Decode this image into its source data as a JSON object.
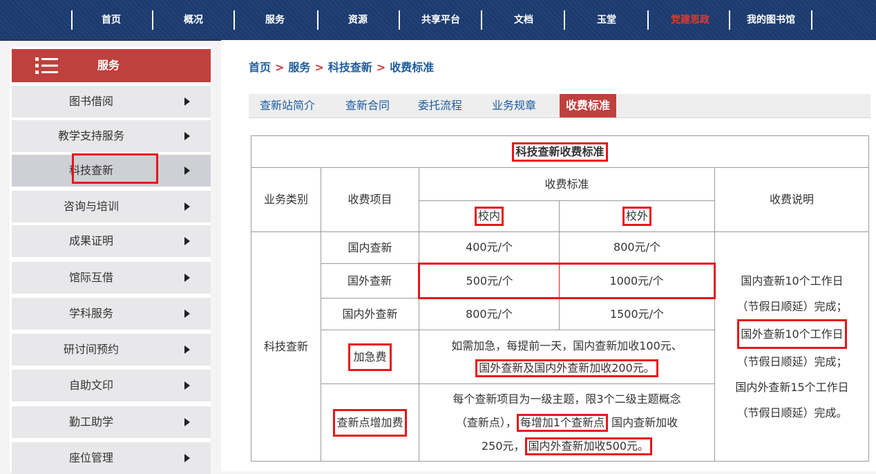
{
  "nav": {
    "items": [
      "首页",
      "概况",
      "服务",
      "资源",
      "共享平台",
      "文档",
      "玉堂",
      "党建思政",
      "我的图书馆"
    ],
    "highlight_color": "#e23b2e"
  },
  "sidebar": {
    "header": "服务",
    "items": [
      "图书借阅",
      "教学支持服务",
      "科技查新",
      "咨询与培训",
      "成果证明",
      "馆际互借",
      "学科服务",
      "研讨间预约",
      "自助文印",
      "勤工助学",
      "座位管理"
    ],
    "active_index": 2
  },
  "breadcrumb": {
    "items": [
      "首页",
      "服务",
      "科技查新",
      "收费标准"
    ],
    "separator": ">"
  },
  "tabs": {
    "items": [
      "查新站简介",
      "查新合同",
      "委托流程",
      "业务规章",
      "收费标准"
    ],
    "active_index": 4
  },
  "table": {
    "caption": "科技查新收费标准",
    "headers": {
      "category": "业务类别",
      "item": "收费项目",
      "standard": "收费标准",
      "internal": "校内",
      "external": "校外",
      "notes": "收费说明"
    },
    "category": "科技查新",
    "rows": [
      {
        "item": "国内查新",
        "internal": "400元/个",
        "external": "800元/个"
      },
      {
        "item": "国外查新",
        "internal": "500元/个",
        "external": "1000元/个"
      },
      {
        "item": "国内外查新",
        "internal": "800元/个",
        "external": "1500元/个"
      }
    ],
    "urgent": {
      "item": "加急费",
      "desc_1": "如需加急，每提前一天，国内查新加收100元、",
      "desc_2": "国外查新及国内外查新加收200元。"
    },
    "extra_points": {
      "item": "查新点增加费",
      "line1": "每个查新项目为一级主题，限3个二级主题概念",
      "line2_a": "（查新点），",
      "line2_b": "每增加1个查新点",
      "line2_c": "国内查新加收",
      "line3_a": "250元，",
      "line3_b": "国内外查新加收500元。"
    },
    "notes": [
      "国内查新10个工作日",
      "（节假日顺延）完成；",
      "国外查新10个工作日",
      "（节假日顺延）完成；",
      "国内外查新15个工作日",
      "（节假日顺延）完成。"
    ]
  },
  "colors": {
    "nav_bg": "#1b3a6e",
    "accent_red": "#c0403d",
    "link_blue": "#1d5c9e",
    "annotation_red": "#e8141a"
  }
}
